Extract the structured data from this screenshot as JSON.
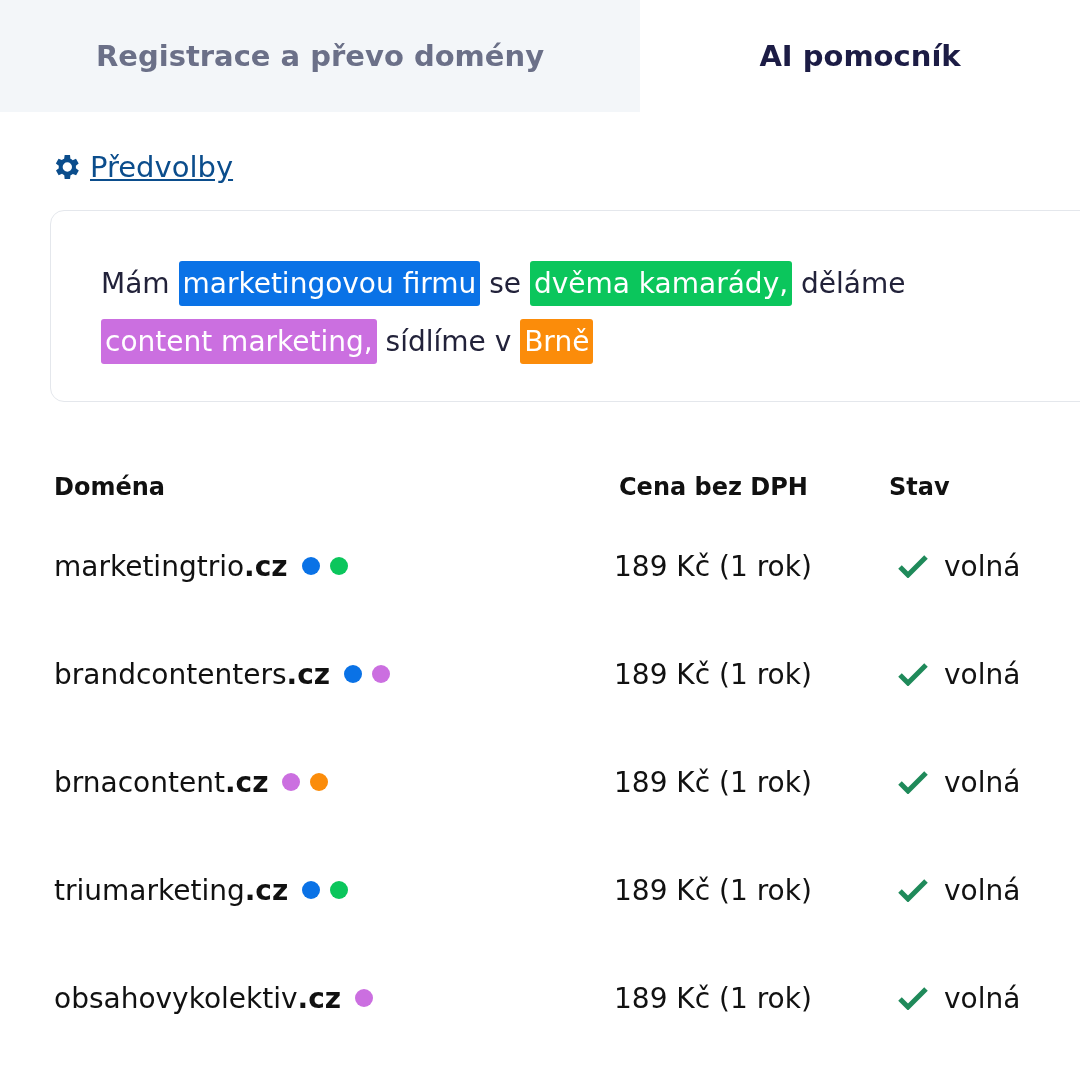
{
  "tabs": [
    {
      "label": "Registrace a převo domény",
      "selected": false
    },
    {
      "label": "AI pomocník",
      "selected": true
    }
  ],
  "preferences_link": "Předvolby",
  "prompt": [
    {
      "text": "Mám"
    },
    {
      "text": "marketingovou firmu",
      "color": "#0a72e6"
    },
    {
      "text": "se"
    },
    {
      "text": "dvěma kamarády,",
      "color": "#0bc65c"
    },
    {
      "text": "děláme"
    },
    {
      "text": "content marketing,",
      "color": "#cb6fe0"
    },
    {
      "text": "sídlíme v"
    },
    {
      "text": "Brně",
      "color": "#fb8c0a"
    }
  ],
  "table": {
    "columns": [
      "Doména",
      "Cena bez DPH",
      "Stav"
    ],
    "rows": [
      {
        "domain": "marketingtrio**.cz**",
        "tags": [
          {
            "color": "#0a72e6"
          },
          {
            "color": "#0bc65c"
          }
        ],
        "price": "189 Kč (1 rok)",
        "available": true,
        "status": "volná"
      },
      {
        "domain": "brandcontenters**.cz**",
        "tags": [
          {
            "color": "#0a72e6"
          },
          {
            "color": "#cb6fe0"
          }
        ],
        "price": "189 Kč (1 rok)",
        "available": true,
        "status": "volná"
      },
      {
        "domain": "brnacontent**.cz**",
        "tags": [
          {
            "color": "#cb6fe0"
          },
          {
            "color": "#fb8c0a"
          }
        ],
        "price": "189 Kč (1 rok)",
        "available": true,
        "status": "volná"
      },
      {
        "domain": "triumarketing**.cz**",
        "tags": [
          {
            "color": "#0a72e6"
          },
          {
            "color": "#0bc65c"
          }
        ],
        "price": "189 Kč (1 rok)",
        "available": true,
        "status": "volná"
      },
      {
        "domain": "obsahovykolektiv**.cz**",
        "tags": [
          {
            "color": "#cb6fe0"
          }
        ],
        "price": "189 Kč (1 rok)",
        "available": true,
        "status": "volná"
      }
    ]
  }
}
